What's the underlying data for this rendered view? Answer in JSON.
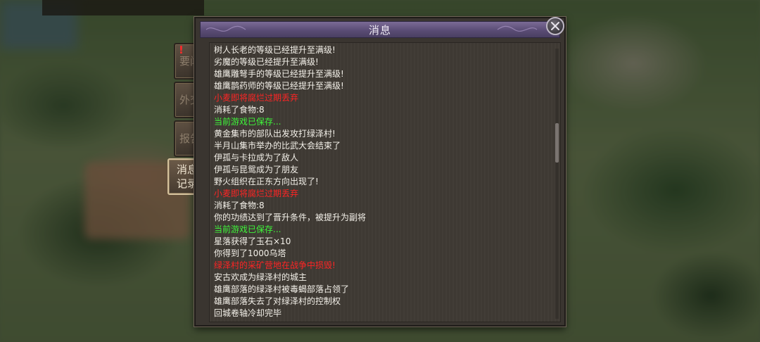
{
  "dialog": {
    "title": "消息"
  },
  "tabs": [
    {
      "label": "要闻",
      "has_alert": true,
      "alert": "!"
    },
    {
      "label": "外交"
    },
    {
      "label": "报告"
    },
    {
      "label_line1": "消息",
      "label_line2": "记录",
      "active": true
    }
  ],
  "messages": [
    {
      "text": "树人长老的等级已经提升至满级!",
      "color": "white"
    },
    {
      "text": "劣魔的等级已经提升至满级!",
      "color": "white"
    },
    {
      "text": "雄鹰雕弩手的等级已经提升至满级!",
      "color": "white"
    },
    {
      "text": "雄鹰鹊药师的等级已经提升至满级!",
      "color": "white"
    },
    {
      "text": "小麦即将腐烂过期丢弃",
      "color": "red"
    },
    {
      "text": "消耗了食物:8",
      "color": "white"
    },
    {
      "text": "当前游戏已保存...",
      "color": "green"
    },
    {
      "text": "黄金集市的部队出发攻打绿泽村!",
      "color": "white"
    },
    {
      "text": "半月山集市举办的比武大会结束了",
      "color": "white"
    },
    {
      "text": "伊孤与卡拉成为了敌人",
      "color": "white"
    },
    {
      "text": "伊孤与昆鸳成为了朋友",
      "color": "white"
    },
    {
      "text": "野火组织在正东方向出现了!",
      "color": "white"
    },
    {
      "text": "小麦即将腐烂过期丢弃",
      "color": "red"
    },
    {
      "text": "消耗了食物:8",
      "color": "white"
    },
    {
      "text": "你的功绩达到了晋升条件，被提升为副将",
      "color": "white"
    },
    {
      "text": "当前游戏已保存...",
      "color": "green"
    },
    {
      "text": "星落获得了玉石×10",
      "color": "white"
    },
    {
      "text": "你得到了1000乌塔",
      "color": "white"
    },
    {
      "text": "绿泽村的采矿营地在战争中损毁!",
      "color": "red"
    },
    {
      "text": "安古欢成为绿泽村的城主",
      "color": "white"
    },
    {
      "text": "雄鹰部落的绿泽村被毒蝎部落占领了",
      "color": "white"
    },
    {
      "text": "雄鹰部落失去了对绿泽村的控制权",
      "color": "white"
    },
    {
      "text": "回城卷轴冷却完毕",
      "color": "white"
    }
  ],
  "icons": {
    "close": "close-icon",
    "alert": "exclamation-icon"
  },
  "colors": {
    "message_white": "#f4f1ea",
    "message_red": "#ff2424",
    "message_green": "#3ef53a",
    "titlebar": "#5a4c75"
  }
}
